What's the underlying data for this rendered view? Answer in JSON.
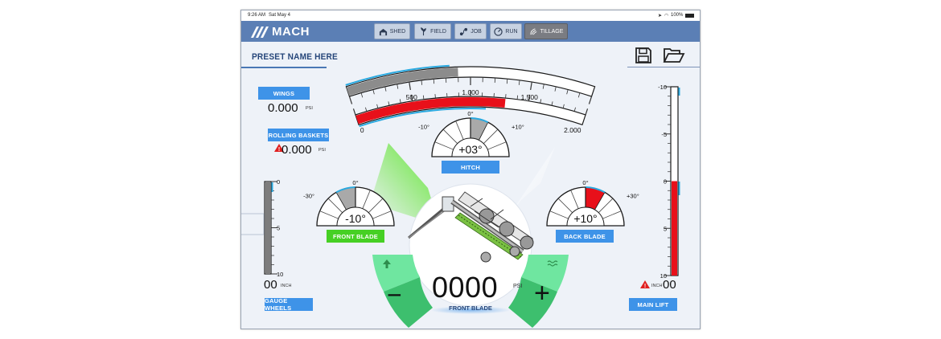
{
  "status_bar": {
    "time": "9:26 AM",
    "date": "Sat May 4",
    "battery": "100%"
  },
  "brand": {
    "name": "MACH"
  },
  "tabs": [
    {
      "label": "SHED",
      "icon": "shed-icon",
      "active": false
    },
    {
      "label": "FIELD",
      "icon": "field-icon",
      "active": false
    },
    {
      "label": "JOB",
      "icon": "job-icon",
      "active": false
    },
    {
      "label": "RUN",
      "icon": "speedometer-icon",
      "active": false
    },
    {
      "label": "TILLAGE",
      "icon": "tillage-icon",
      "active": true
    }
  ],
  "preset": {
    "name": "PRESET NAME HERE"
  },
  "toolbar": {
    "save_icon": "save-icon",
    "open_icon": "folder-open-icon"
  },
  "pressure_arc": {
    "ticks": [
      "0",
      "500",
      "1.000",
      "1.500",
      "2.000"
    ],
    "min": 0,
    "max": 2000,
    "outer_fill": 900,
    "inner_fill": 1300,
    "colors": {
      "outer": "#8c8c8c",
      "inner": "#e8101a",
      "accent": "#29a9e0"
    }
  },
  "wings": {
    "label": "WINGS",
    "value": "0.000",
    "unit": "PSI"
  },
  "rolling_baskets": {
    "label": "ROLLING BASKETS",
    "value": "0.000",
    "unit": "PSI",
    "alert": true
  },
  "hitch": {
    "label": "HITCH",
    "value": "+03°",
    "top": "0°",
    "left": "-10°",
    "right": "+10°",
    "angle": 3
  },
  "front_blade": {
    "label": "FRONT BLADE",
    "value": "-10°",
    "top": "0°",
    "left": "-30°",
    "angle": -10
  },
  "back_blade": {
    "label": "BACK BLADE",
    "value": "+10°",
    "top": "0°",
    "right": "+30°",
    "angle": 10
  },
  "gauge_wheels": {
    "label": "GAUGE WHEELS",
    "value": "00",
    "unit": "INCH",
    "scale": [
      "0",
      "5",
      "10"
    ],
    "fill_fraction": 0.0
  },
  "main_lift": {
    "label": "MAIN LIFT",
    "value": "00",
    "unit": "INCH",
    "alert": true,
    "scale": [
      "-10",
      "-5",
      "0",
      "5",
      "10"
    ],
    "fill_fraction": 1.0
  },
  "center": {
    "value": "0000",
    "unit": "PSI",
    "label": "FRONT BLADE",
    "minus": "−",
    "plus": "+",
    "up_icon": "arrow-up-icon",
    "wave_icon": "wave-icon"
  },
  "colors": {
    "primary": "#5b7fb5",
    "label_blue": "#3e93e8",
    "label_green": "#46d024",
    "alert_red": "#e02020",
    "control_green": "#3dbf6e"
  }
}
